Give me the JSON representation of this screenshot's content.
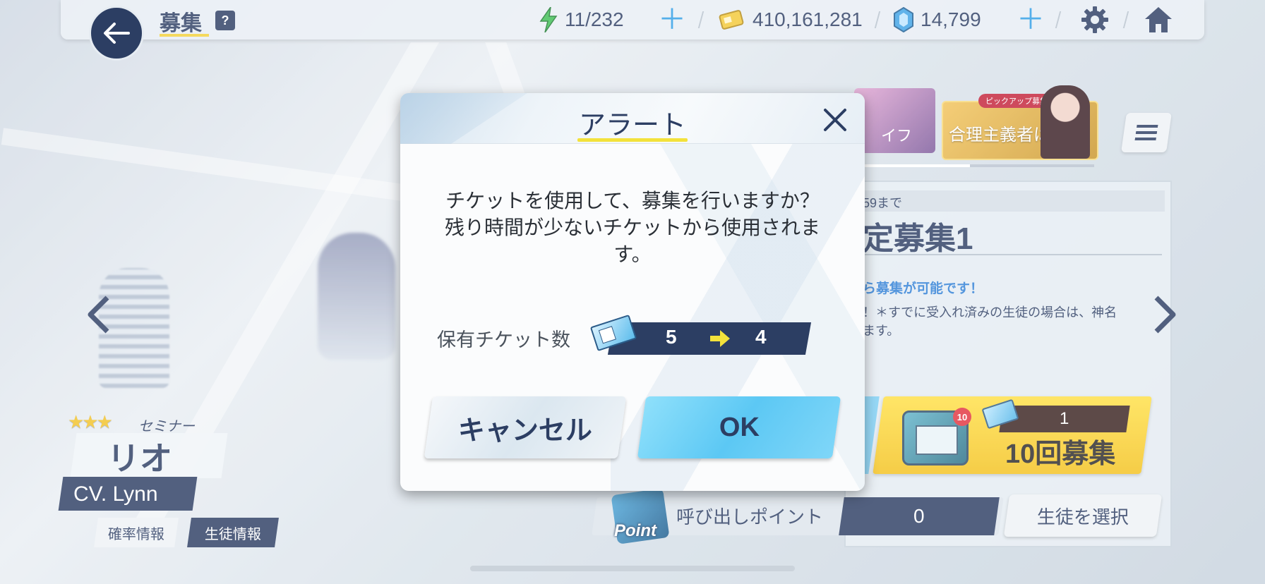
{
  "header": {
    "title": "募集",
    "help_label": "?",
    "ap": "11/232",
    "credits": "410,161,281",
    "pyroxene": "14,799"
  },
  "banners": {
    "thumb_a_text": "イフ",
    "pickup_tag": "ピックアップ募集",
    "pickup_text": "合理主義者は"
  },
  "gacha": {
    "period": "59まで",
    "name": "定募集1",
    "note1": "ら募集が可能です！",
    "note2_line1": "！＊すでに受入れ済みの生徒の場合は、神名",
    "note2_line2": "ます。",
    "pull10_badge": "10",
    "pull10_ticket_count": "1",
    "pull10_label": "10回募集",
    "point_word": "Point",
    "point_label": "呼び出しポイント",
    "point_value": "0",
    "select_student": "生徒を選択"
  },
  "character": {
    "stars": "★★★",
    "role": "セミナー",
    "name": "リオ",
    "cv": "CV. Lynn",
    "rate_info": "確率情報",
    "student_info": "生徒情報"
  },
  "dialog": {
    "title": "アラート",
    "message_line1": "チケットを使用して、募集を行いますか？",
    "message_line2": "残り時間が少ないチケットから使用されま",
    "message_line3": "す。",
    "ticket_label": "保有チケット数",
    "ticket_from": "5",
    "ticket_to": "4",
    "cancel": "キャンセル",
    "ok": "OK"
  },
  "colors": {
    "navy": "#2c3e63",
    "accent_yellow": "#f3e23b",
    "ok_blue": "#5cc8f4",
    "plus_blue": "#2f9ee6"
  }
}
